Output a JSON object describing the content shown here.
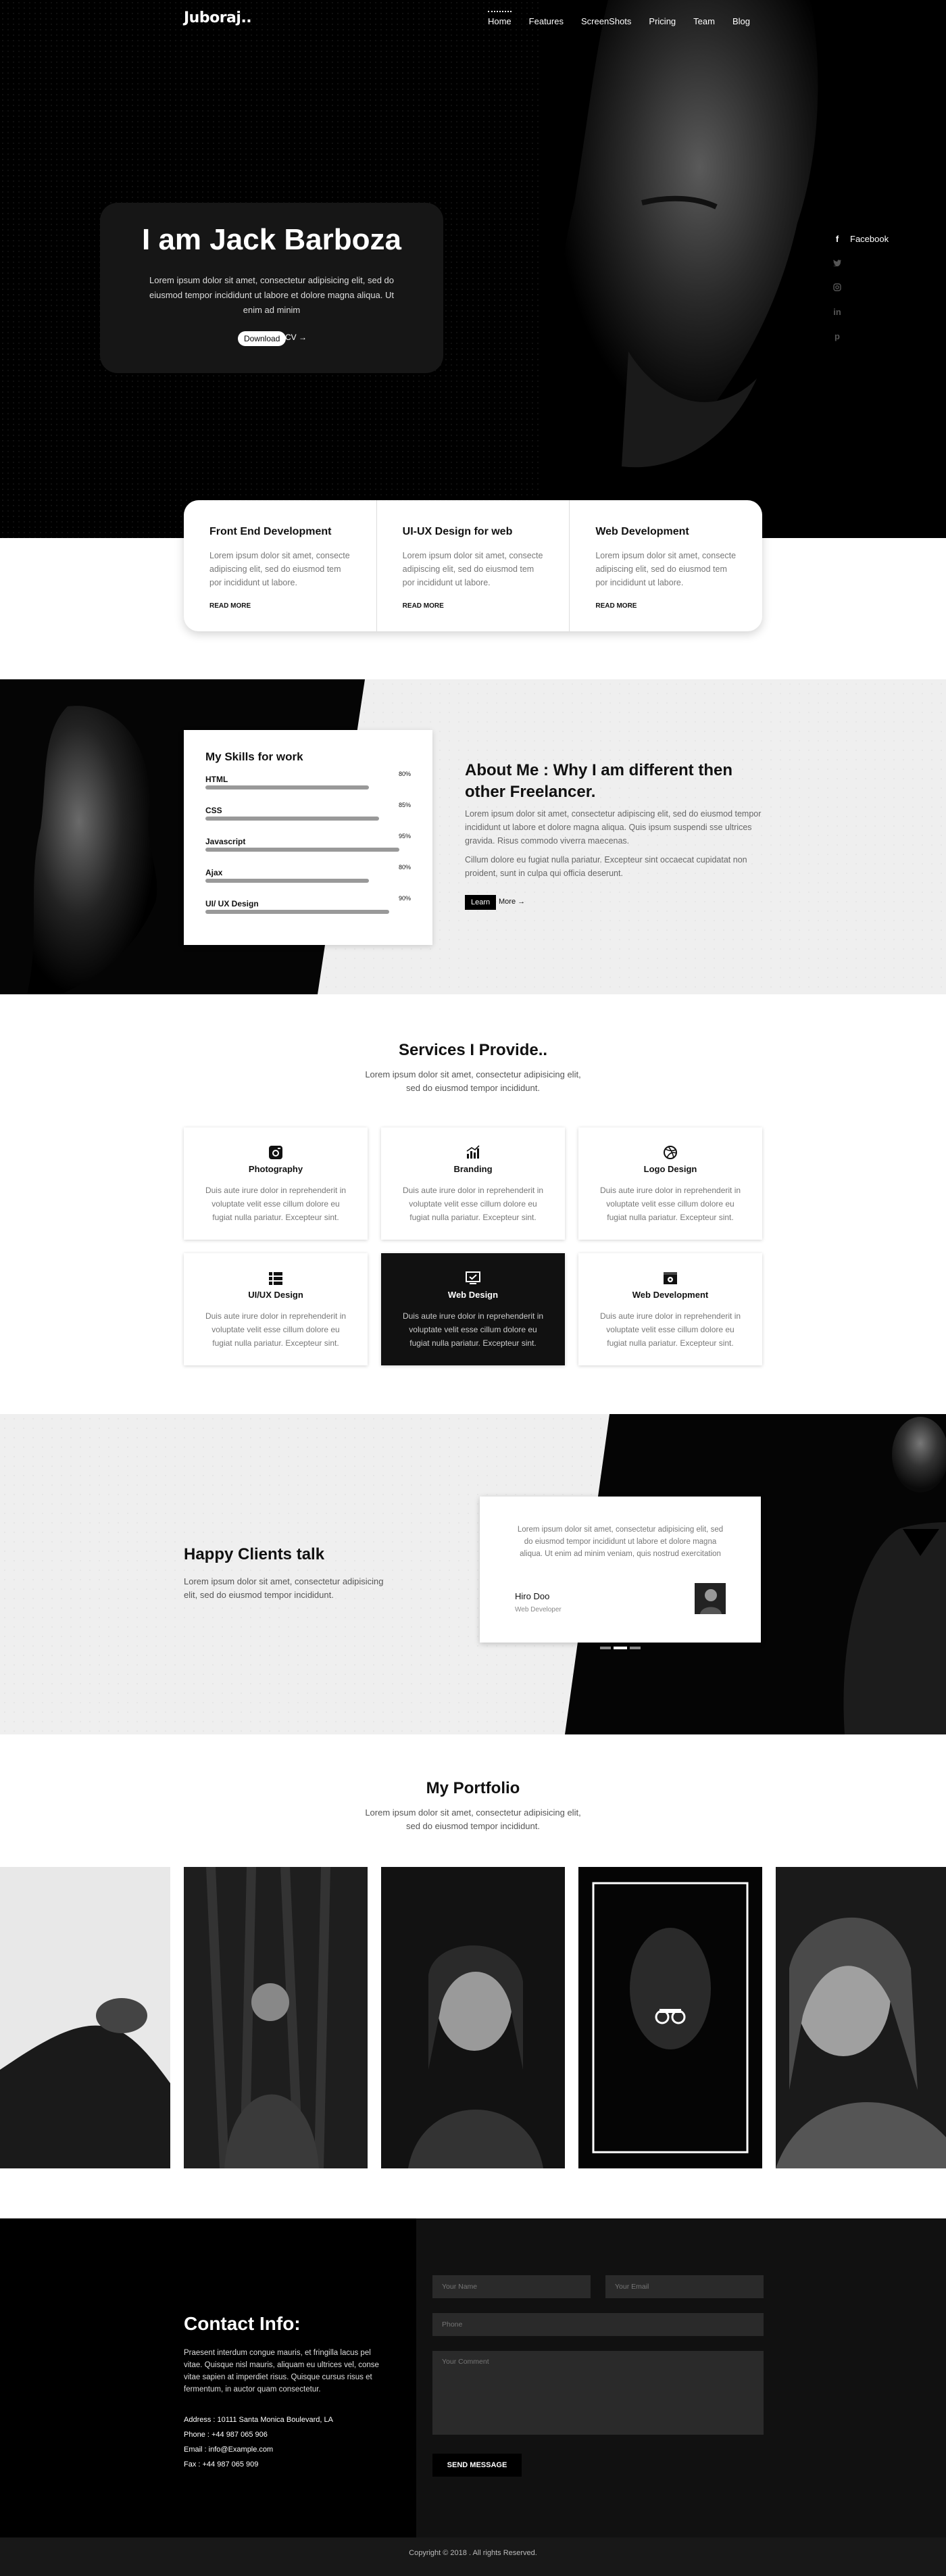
{
  "nav": {
    "logo": "Juboraj..",
    "items": [
      "Home",
      "Features",
      "ScreenShots",
      "Pricing",
      "Team",
      "Blog"
    ]
  },
  "hero": {
    "title": "I am Jack Barboza",
    "text": "Lorem ipsum dolor sit amet, consectetur adipisicing elit, sed do eiusmod tempor incididunt ut labore et dolore magna aliqua. Ut enim ad minim",
    "download_label": "Download",
    "cv_label": "CV →",
    "social": [
      {
        "icon": "facebook-icon",
        "label": "Facebook"
      },
      {
        "icon": "twitter-icon",
        "label": ""
      },
      {
        "icon": "instagram-icon",
        "label": ""
      },
      {
        "icon": "linkedin-icon",
        "label": ""
      },
      {
        "icon": "pinterest-icon",
        "label": ""
      }
    ]
  },
  "top_services": [
    {
      "title": "Front End Development",
      "text": "Lorem ipsum dolor sit amet, consecte adipiscing elit, sed do eiusmod tem por incididunt ut labore.",
      "link": "READ MORE"
    },
    {
      "title": "UI-UX Design for web",
      "text": "Lorem ipsum dolor sit amet, consecte adipiscing elit, sed do eiusmod tem por incididunt ut labore.",
      "link": "READ MORE"
    },
    {
      "title": "Web Development",
      "text": "Lorem ipsum dolor sit amet, consecte adipiscing elit, sed do eiusmod tem por incididunt ut labore.",
      "link": "READ MORE"
    }
  ],
  "skills": {
    "title": "My Skills for work",
    "items": [
      {
        "name": "HTML",
        "pct": "80%",
        "value": 80
      },
      {
        "name": "CSS",
        "pct": "85%",
        "value": 85
      },
      {
        "name": "Javascript",
        "pct": "95%",
        "value": 95
      },
      {
        "name": "Ajax",
        "pct": "80%",
        "value": 80
      },
      {
        "name": "UI/ UX Design",
        "pct": "90%",
        "value": 90
      }
    ]
  },
  "about": {
    "heading": "About Me : Why I am different then other Freelancer.",
    "p1": "Lorem ipsum dolor sit amet, consectetur adipiscing elit, sed do eiusmod tempor incididunt ut labore et dolore magna aliqua. Quis ipsum suspendi sse ultrices gravida. Risus commodo viverra maecenas.",
    "p2": "Cillum dolore eu fugiat nulla pariatur. Excepteur sint occaecat cupidatat non proident, sunt in culpa qui officia deserunt.",
    "learn_label": "Learn",
    "more_label": "More →"
  },
  "services": {
    "title": "Services I Provide..",
    "subtitle": "Lorem ipsum dolor sit amet, consectetur adipisicing elit, sed do eiusmod tempor incididunt.",
    "items": [
      {
        "name": "Photography",
        "icon": "camera-icon",
        "text": "Duis aute irure dolor in reprehenderit in voluptate velit esse cillum dolore eu fugiat nulla pariatur. Excepteur sint."
      },
      {
        "name": "Branding",
        "icon": "bar-chart-icon",
        "text": "Duis aute irure dolor in reprehenderit in voluptate velit esse cillum dolore eu fugiat nulla pariatur. Excepteur sint."
      },
      {
        "name": "Logo Design",
        "icon": "dribbble-icon",
        "text": "Duis aute irure dolor in reprehenderit in voluptate velit esse cillum dolore eu fugiat nulla pariatur. Excepteur sint."
      },
      {
        "name": "UI/UX Design",
        "icon": "grid-list-icon",
        "text": "Duis aute irure dolor in reprehenderit in voluptate velit esse cillum dolore eu fugiat nulla pariatur. Excepteur sint."
      },
      {
        "name": "Web Design",
        "icon": "monitor-check-icon",
        "text": "Duis aute irure dolor in reprehenderit in voluptate velit esse cillum dolore eu fugiat nulla pariatur. Excepteur sint."
      },
      {
        "name": "Web Development",
        "icon": "browser-gear-icon",
        "text": "Duis aute irure dolor in reprehenderit in voluptate velit esse cillum dolore eu fugiat nulla pariatur. Excepteur sint."
      }
    ]
  },
  "clients": {
    "title": "Happy Clients talk",
    "text": "Lorem ipsum dolor sit amet, consectetur adipisicing elit, sed do eiusmod tempor incididunt.",
    "quote": "Lorem ipsum dolor sit amet, consectetur adipisicing elit, sed do eiusmod tempor incididunt ut labore et dolore magna aliqua. Ut enim ad minim veniam, quis nostrud exercitation",
    "name": "Hiro Doo",
    "role": "Web Developer"
  },
  "portfolio": {
    "title": "My Portfolio",
    "subtitle": "Lorem ipsum dolor sit amet, consectetur adipisicing elit, sed do eiusmod tempor incididunt."
  },
  "contact": {
    "title": "Contact Info:",
    "text": "Praesent interdum congue mauris, et fringilla lacus pel vitae. Quisque nisl mauris, aliquam eu ultrices vel, conse vitae sapien at imperdiet risus. Quisque cursus risus et fermentum, in auctor quam consectetur.",
    "address": "Address : 10111 Santa Monica Boulevard, LA",
    "phone": "Phone : +44 987 065 906",
    "email": "Email : info@Example.com",
    "fax": "Fax : +44 987 065 909",
    "form": {
      "name_ph": "Your Name",
      "email_ph": "Your Email",
      "phone_ph": "Phone",
      "comment_ph": "Your Comment",
      "send_label": "SEND MESSAGE"
    }
  },
  "footer": "Copyright © 2018 . All rights Reserved."
}
